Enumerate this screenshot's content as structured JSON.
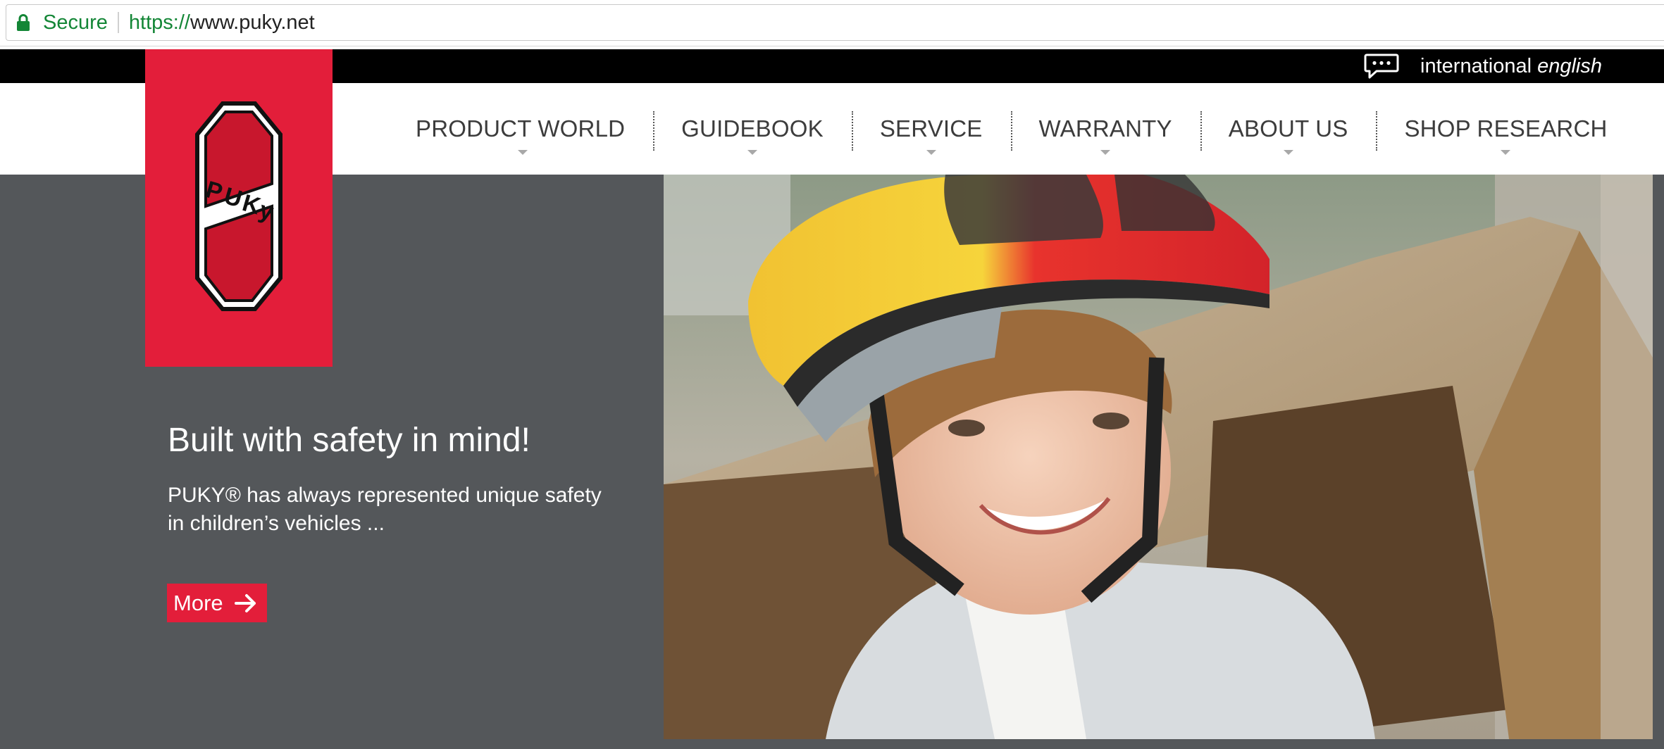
{
  "browser": {
    "secure_label": "Secure",
    "url_scheme": "https://",
    "url_rest": "www.puky.net",
    "security_color": "#138636",
    "icons": {
      "lock": "lock-icon"
    }
  },
  "top_bar": {
    "language_prefix": "international",
    "language_name": "english",
    "icons": {
      "language": "speech-bubble-icon"
    }
  },
  "brand": {
    "logo_text": "PUKY",
    "color": "#e31e3a"
  },
  "nav": {
    "items": [
      {
        "label": "PRODUCT WORLD"
      },
      {
        "label": "GUIDEBOOK"
      },
      {
        "label": "SERVICE"
      },
      {
        "label": "WARRANTY"
      },
      {
        "label": "ABOUT US"
      },
      {
        "label": "SHOP RESEARCH"
      }
    ]
  },
  "hero": {
    "title": "Built with safety in mind!",
    "text": "PUKY® has always represented unique safety in children’s vehicles ...",
    "button_label": "More",
    "background_color": "#54575a",
    "icons": {
      "button": "arrow-right-icon",
      "photo": "child-with-helmet-photo"
    }
  }
}
